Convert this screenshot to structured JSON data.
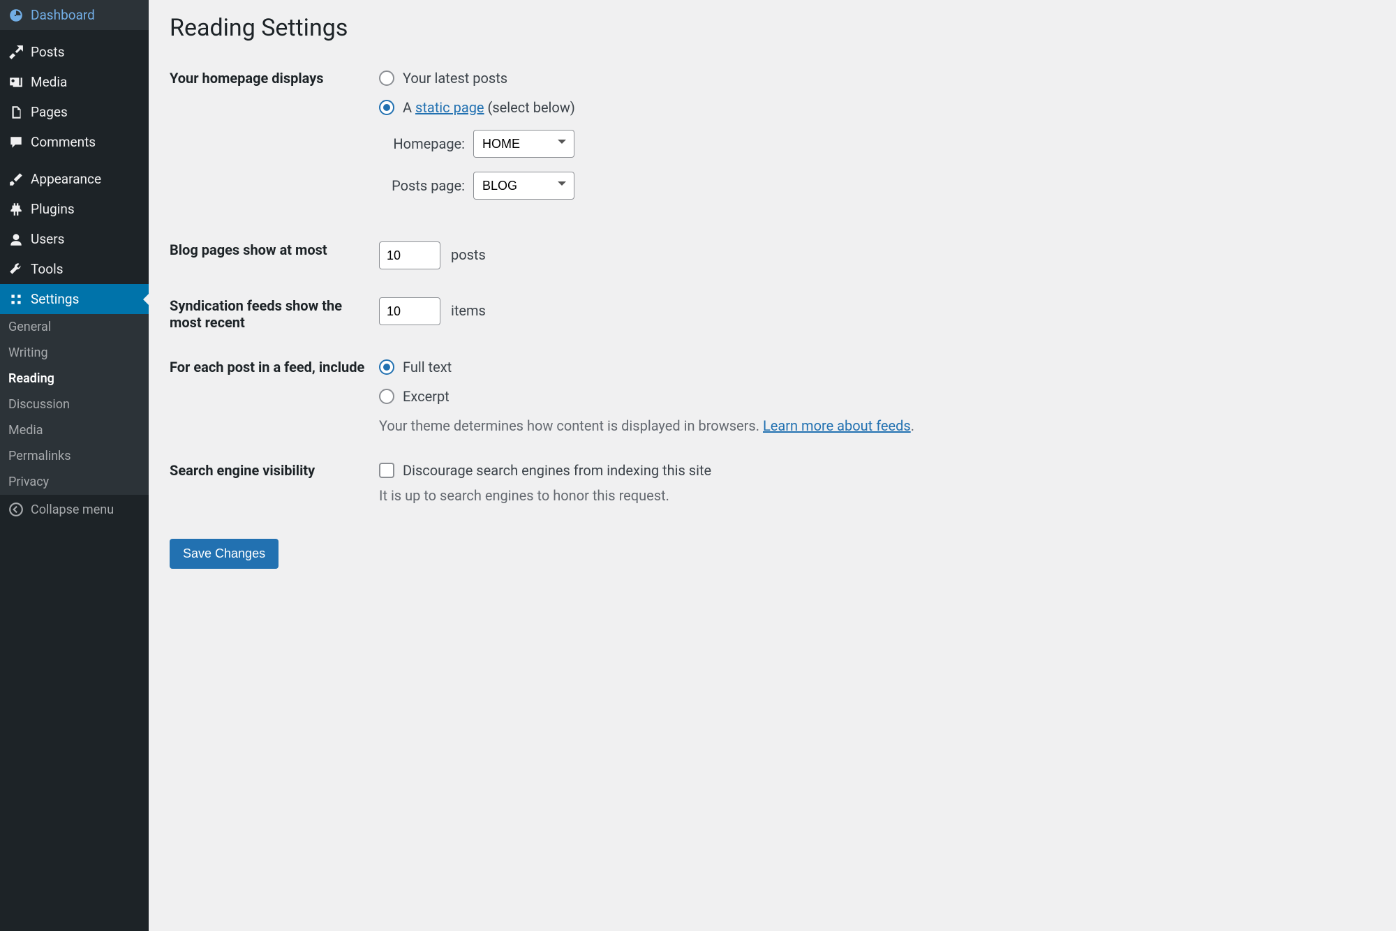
{
  "sidebar": {
    "items": [
      {
        "label": "Dashboard",
        "icon": "dashboard"
      },
      {
        "label": "Posts",
        "icon": "pin"
      },
      {
        "label": "Media",
        "icon": "media"
      },
      {
        "label": "Pages",
        "icon": "pages"
      },
      {
        "label": "Comments",
        "icon": "comments"
      },
      {
        "label": "Appearance",
        "icon": "brush"
      },
      {
        "label": "Plugins",
        "icon": "plugins"
      },
      {
        "label": "Users",
        "icon": "users"
      },
      {
        "label": "Tools",
        "icon": "tools"
      },
      {
        "label": "Settings",
        "icon": "settings",
        "active": true
      }
    ],
    "submenu": [
      {
        "label": "General"
      },
      {
        "label": "Writing"
      },
      {
        "label": "Reading",
        "current": true
      },
      {
        "label": "Discussion"
      },
      {
        "label": "Media"
      },
      {
        "label": "Permalinks"
      },
      {
        "label": "Privacy"
      }
    ],
    "collapse_label": "Collapse menu"
  },
  "page": {
    "title": "Reading Settings",
    "homepage_displays_label": "Your homepage displays",
    "radio_latest_posts": "Your latest posts",
    "radio_static_prefix": "A ",
    "radio_static_link": "static page",
    "radio_static_suffix": " (select below)",
    "homepage_label": "Homepage:",
    "homepage_value": "HOME",
    "posts_page_label": "Posts page:",
    "posts_page_value": "BLOG",
    "blog_pages_label": "Blog pages show at most",
    "blog_pages_value": "10",
    "blog_pages_unit": "posts",
    "syndication_label": "Syndication feeds show the most recent",
    "syndication_value": "10",
    "syndication_unit": "items",
    "feed_include_label": "For each post in a feed, include",
    "radio_full_text": "Full text",
    "radio_excerpt": "Excerpt",
    "feed_note_prefix": "Your theme determines how content is displayed in browsers. ",
    "feed_note_link": "Learn more about feeds",
    "feed_note_suffix": ".",
    "search_engine_label": "Search engine visibility",
    "search_engine_checkbox_label": "Discourage search engines from indexing this site",
    "search_engine_note": "It is up to search engines to honor this request.",
    "save_button": "Save Changes"
  }
}
